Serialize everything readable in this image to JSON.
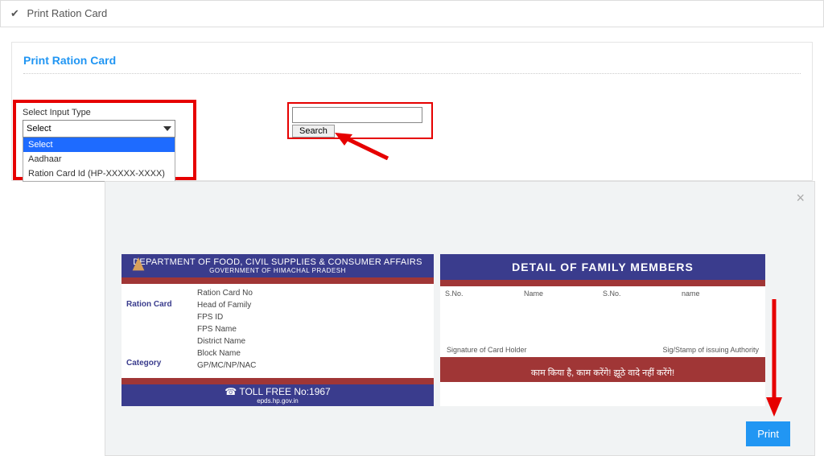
{
  "topBar": {
    "title": "Print Ration Card"
  },
  "innerCard": {
    "title": "Print Ration Card"
  },
  "inputType": {
    "label": "Select Input Type",
    "selected": "Select",
    "options": {
      "o1": "Select",
      "o2": "Aadhaar",
      "o3": "Ration Card Id (HP-XXXXX-XXXX)"
    }
  },
  "searchBtn": "Search",
  "cardHeader": {
    "line1": "DEPARTMENT OF FOOD, CIVIL SUPPLIES & CONSUMER AFFAIRS",
    "line2": "GOVERNMENT OF HIMACHAL PRADESH"
  },
  "leftLabels": {
    "ration": "Ration Card",
    "category": "Category"
  },
  "fields": {
    "f1": "Ration Card No",
    "f2": "Head of Family",
    "f3": "FPS ID",
    "f4": "FPS Name",
    "f5": "District Name",
    "f6": "Block Name",
    "f7": "GP/MC/NP/NAC"
  },
  "tollFree": {
    "phone": "☎ TOLL FREE No:1967",
    "site": "epds.hp.gov.in"
  },
  "rightHeader": "DETAIL OF FAMILY MEMBERS",
  "tableHead": {
    "c1": "S.No.",
    "c2": "Name",
    "c3": "S.No.",
    "c4": "name"
  },
  "sig": {
    "left": "Signature of Card Holder",
    "right": "Sig/Stamp of issuing Authority"
  },
  "banner": "काम किया है, काम करेंगे! झूठे वादे नहीं करेंगे!",
  "printBtn": "Print"
}
